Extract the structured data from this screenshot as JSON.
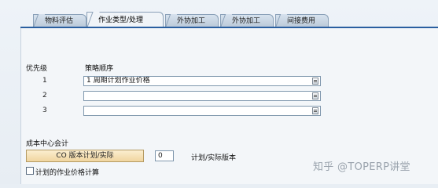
{
  "tabs": [
    {
      "label": "物料评估"
    },
    {
      "label": "作业类型/处理",
      "active": true
    },
    {
      "label": "外协加工"
    },
    {
      "label": "外协加工"
    },
    {
      "label": "间接费用"
    }
  ],
  "strategy": {
    "priority_header": "优先级",
    "sequence_header": "策略顺序",
    "rows": [
      {
        "num": "1",
        "value": "1 周期计划作业价格"
      },
      {
        "num": "2",
        "value": ""
      },
      {
        "num": "3",
        "value": ""
      }
    ]
  },
  "cost_center": {
    "section_label": "成本中心会计",
    "co_button_label": "CO 版本计划/实际",
    "version_value": "0",
    "version_label": "计划/实际版本",
    "checkbox_label": "计划的作业价格计算"
  },
  "watermark": "知乎 @TOPERP讲堂"
}
